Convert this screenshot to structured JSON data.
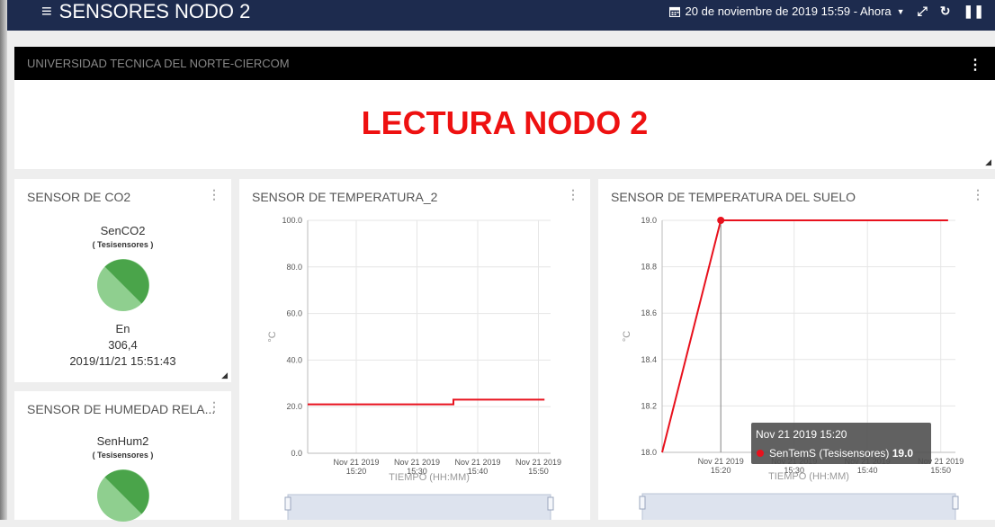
{
  "header": {
    "title": "SENSORES NODO 2",
    "date_range": "20 de noviembre de 2019 15:59 - Ahora"
  },
  "banner": {
    "heading": "UNIVERSIDAD TECNICA DEL NORTE-CIERCOM",
    "text": "LECTURA NODO 2",
    "text_color": "#ee1111"
  },
  "co2_card": {
    "title": "SENSOR DE CO2",
    "sensor_name": "SenCO2",
    "device": "( Tesisensores )",
    "status": "En",
    "value": "306,4",
    "timestamp": "2019/11/21 15:51:43"
  },
  "humidity_card": {
    "title": "SENSOR DE HUMEDAD RELA...",
    "sensor_name": "SenHum2",
    "device": "( Tesisensores )"
  },
  "temp_card": {
    "title": "SENSOR DE TEMPERATURA_2",
    "chart_data": {
      "type": "line",
      "ylabel": "°C",
      "xlabel": "TIEMPO (HH:MM)",
      "ylim": [
        0,
        100
      ],
      "y_ticks": [
        "0.0",
        "20.0",
        "40.0",
        "60.0",
        "80.0",
        "100.0"
      ],
      "x_ticks": [
        {
          "date": "Nov 21 2019",
          "time": "15:20"
        },
        {
          "date": "Nov 21 2019",
          "time": "15:30"
        },
        {
          "date": "Nov 21 2019",
          "time": "15:40"
        },
        {
          "date": "Nov 21 2019",
          "time": "15:50"
        }
      ],
      "series_color": "#e8111d",
      "points": [
        {
          "x": "15:12",
          "y": 21
        },
        {
          "x": "15:36",
          "y": 21
        },
        {
          "x": "15:36",
          "y": 23
        },
        {
          "x": "15:51",
          "y": 23
        }
      ]
    }
  },
  "soil_card": {
    "title": "SENSOR DE TEMPERATURA DEL SUELO",
    "chart_data": {
      "type": "line",
      "ylabel": "°C",
      "xlabel": "TIEMPO (HH:MM)",
      "ylim": [
        18.0,
        19.0
      ],
      "y_ticks": [
        "18.0",
        "18.2",
        "18.4",
        "18.6",
        "18.8",
        "19.0"
      ],
      "x_ticks": [
        {
          "date": "Nov 21 2019",
          "time": "15:20"
        },
        {
          "date": "Nov 21 2019",
          "time": "15:30"
        },
        {
          "date": "Nov 21 2019",
          "time": "15:40"
        },
        {
          "date": "Nov 21 2019",
          "time": "15:50"
        }
      ],
      "series_color": "#e8111d",
      "points": [
        {
          "x": "15:12",
          "y": 18.0
        },
        {
          "x": "15:20",
          "y": 19.0
        },
        {
          "x": "15:51",
          "y": 19.0
        }
      ],
      "tooltip": {
        "title": "Nov 21 2019 15:20",
        "series": "SenTemS (Tesisensores)",
        "value": "19.0"
      }
    }
  }
}
